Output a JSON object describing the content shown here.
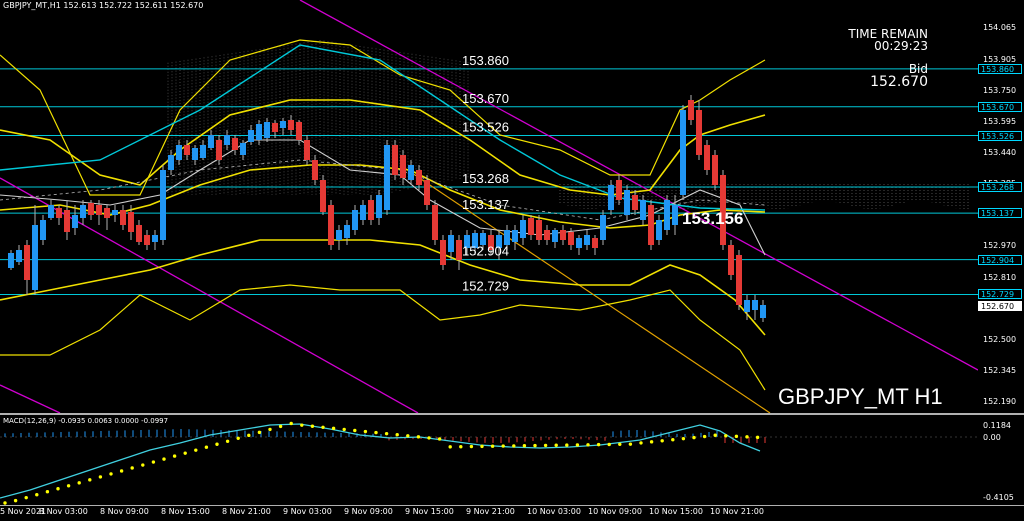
{
  "window": {
    "title": "GBPJPY_MT,H1  152.613 152.722 152.611 152.670",
    "watermark": "GBPJPY_MT H1",
    "timer_label": "TIME REMAIN",
    "timer_value": "00:29:23",
    "bid_label": "Bid",
    "bid_value": "152.670",
    "highlight_level": "153.156"
  },
  "price_axis": {
    "ticks": [
      "154.065",
      "153.905",
      "153.750",
      "153.595",
      "153.440",
      "153.285",
      "153.130",
      "152.970",
      "152.810",
      "152.655",
      "152.500",
      "152.345",
      "152.190"
    ],
    "tags": [
      {
        "value": "153.860",
        "kind": "level"
      },
      {
        "value": "153.670",
        "kind": "level"
      },
      {
        "value": "153.526",
        "kind": "level"
      },
      {
        "value": "153.268",
        "kind": "level"
      },
      {
        "value": "153.137",
        "kind": "level"
      },
      {
        "value": "152.904",
        "kind": "level"
      },
      {
        "value": "152.729",
        "kind": "level"
      },
      {
        "value": "152.670",
        "kind": "bid"
      }
    ]
  },
  "levels": [
    "153.860",
    "153.670",
    "153.526",
    "153.268",
    "153.137",
    "152.904",
    "152.729"
  ],
  "macd": {
    "title": "MACD(12,26,9) -0.0935 0.0063 0.0000 -0.0997",
    "ticks": [
      "0.1184",
      "0.00",
      "-0.4105"
    ]
  },
  "time_axis": {
    "labels": [
      "5 Nov 2021",
      "8 Nov 03:00",
      "8 Nov 09:00",
      "8 Nov 15:00",
      "8 Nov 21:00",
      "9 Nov 03:00",
      "9 Nov 09:00",
      "9 Nov 15:00",
      "9 Nov 21:00",
      "10 Nov 03:00",
      "10 Nov 09:00",
      "10 Nov 15:00",
      "10 Nov 21:00"
    ]
  },
  "colors": {
    "bull": "#2196f3",
    "bear": "#e53935",
    "level_line": "#00c8d8",
    "trend_line": "#d000d0",
    "channel": "#f0e000",
    "macd_line": "#40d0e0",
    "signal": "#ffff00",
    "hist": "#2196f3"
  }
}
